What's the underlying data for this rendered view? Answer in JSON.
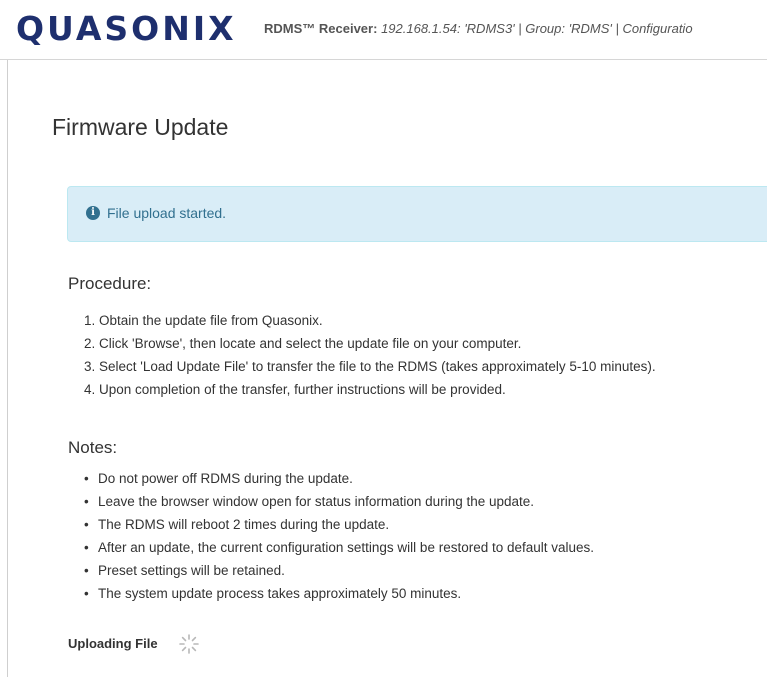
{
  "header": {
    "logo_text": "QUASONIX",
    "receiver_label": "RDMS™ Receiver:",
    "receiver_value": "192.168.1.54: 'RDMS3' | Group: 'RDMS' | Configuratio"
  },
  "main": {
    "title": "Firmware Update",
    "alert": {
      "icon": "info-icon",
      "text": "File upload started."
    },
    "procedure": {
      "heading": "Procedure:",
      "items": [
        "1. Obtain the update file from Quasonix.",
        "2. Click 'Browse', then locate and select the update file on your computer.",
        "3. Select 'Load Update File' to transfer the file to the RDMS (takes approximately 5-10 minutes).",
        "4. Upon completion of the transfer, further instructions will be provided."
      ]
    },
    "notes": {
      "heading": "Notes:",
      "items": [
        "Do not power off RDMS during the update.",
        "Leave the browser window open for status information during the update.",
        "The RDMS will reboot 2 times during the update.",
        "After an update, the current configuration settings will be restored to default values.",
        "Preset settings will be retained.",
        "The system update process takes approximately 50 minutes."
      ]
    },
    "status": {
      "label": "Uploading File",
      "icon": "spinner-icon"
    }
  },
  "colors": {
    "brand": "#1e2f6e",
    "alert_bg": "#d9edf7",
    "alert_text": "#31708f"
  }
}
